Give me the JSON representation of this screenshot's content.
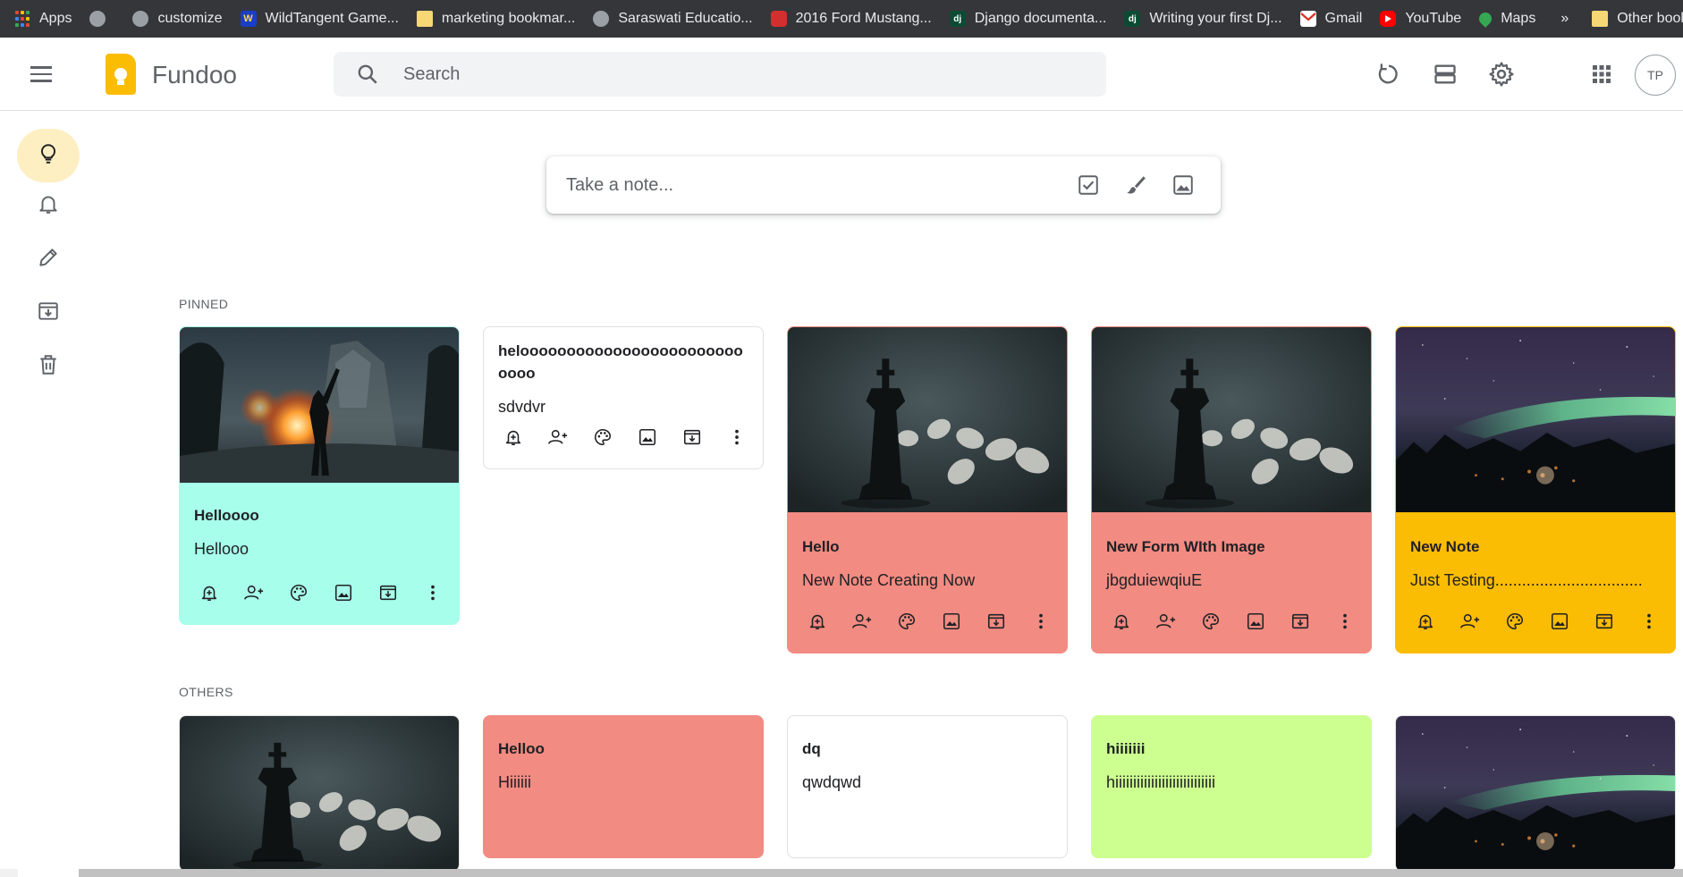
{
  "bookmarks": [
    {
      "label": "Apps",
      "icon": "apps-grid-icon"
    },
    {
      "label": "",
      "icon": "globe-icon"
    },
    {
      "label": "customize",
      "icon": "globe-icon"
    },
    {
      "label": "WildTangent Game...",
      "icon": "wildtangent-icon"
    },
    {
      "label": "marketing bookmar...",
      "icon": "folder-icon"
    },
    {
      "label": "Saraswati Educatio...",
      "icon": "globe-icon"
    },
    {
      "label": "2016 Ford Mustang...",
      "icon": "ford-icon"
    },
    {
      "label": "Django documenta...",
      "icon": "django-icon"
    },
    {
      "label": "Writing your first Dj...",
      "icon": "django-icon"
    },
    {
      "label": "Gmail",
      "icon": "gmail-icon"
    },
    {
      "label": "YouTube",
      "icon": "youtube-icon"
    },
    {
      "label": "Maps",
      "icon": "maps-icon"
    }
  ],
  "bookmarks_more": "»",
  "other_bookmarks": "Other bookma",
  "header": {
    "title": "Fundoo",
    "search_placeholder": "Search",
    "avatar_initials": "TP"
  },
  "take_note": {
    "placeholder": "Take a note..."
  },
  "sections": {
    "pinned": "PINNED",
    "others": "OTHERS"
  },
  "colors": {
    "teal": "#a7ffeb",
    "red": "#f28b82",
    "yellow": "#fbbc04",
    "green": "#ccff90",
    "white": "#ffffff",
    "brand": "#fbbc04"
  },
  "pinned_notes": [
    {
      "title": "Helloooo",
      "body": "Hellooo",
      "color": "#a7ffeb",
      "image": "battlefield-soldier"
    },
    {
      "title": "heloooooooooooooooooooooooooooo",
      "body": "sdvdvr",
      "color": "#ffffff",
      "image": ""
    },
    {
      "title": "Hello",
      "body": "New Note Creating Now",
      "color": "#f28b82",
      "image": "chess-king"
    },
    {
      "title": "New Form WIth Image",
      "body": "jbgduiewqiuE",
      "color": "#f28b82",
      "image": "chess-king"
    },
    {
      "title": "New Note",
      "body": "Just Testing.................................",
      "color": "#fbbc04",
      "image": "aurora-night"
    }
  ],
  "other_notes": [
    {
      "title": "",
      "body": "",
      "color": "#ffffff",
      "image": "chess-king"
    },
    {
      "title": "Helloo",
      "body": "Hiiiiii",
      "color": "#f28b82",
      "image": ""
    },
    {
      "title": "dq",
      "body": "qwdqwd",
      "color": "#ffffff",
      "image": ""
    },
    {
      "title": "hiiiiiii",
      "body": "hiiiiiiiiiiiiiiiiiiiiiiiiiiii",
      "color": "#ccff90",
      "image": ""
    },
    {
      "title": "",
      "body": "",
      "color": "#ffffff",
      "image": "aurora-night"
    }
  ]
}
